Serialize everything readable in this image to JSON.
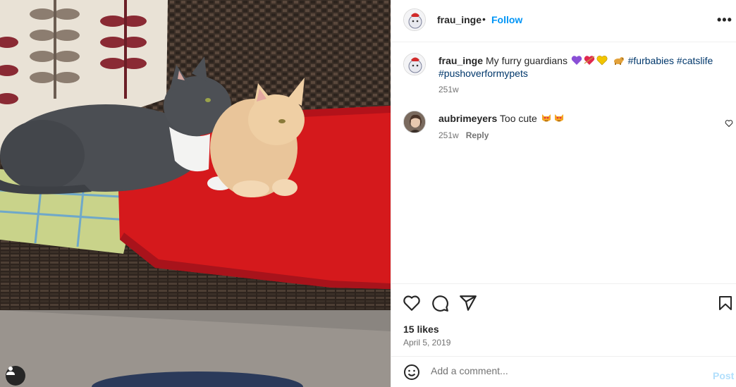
{
  "post": {
    "author": "frau_inge",
    "separator": "•",
    "follow_label": "Follow",
    "more_icon": "more-horizontal-icon",
    "more_glyph": "•••"
  },
  "caption": {
    "username": "frau_inge",
    "text": "My furry guardians",
    "emojis": [
      "purple-heart",
      "heart-with-arrow",
      "yellow-heart",
      "dog"
    ],
    "hashtags": [
      "#furbabies",
      "#catslife",
      "#pushoverformypets"
    ],
    "time": "251w"
  },
  "comments": [
    {
      "username": "aubrimeyers",
      "text": "Too cute",
      "emojis": [
        "smiling-cat-heart-eyes",
        "smiling-cat-heart-eyes"
      ],
      "time": "251w",
      "reply_label": "Reply"
    }
  ],
  "actions": {
    "icons": [
      "heart-icon",
      "comment-icon",
      "share-icon",
      "bookmark-icon"
    ],
    "likes": "15 likes",
    "date": "April 5, 2019"
  },
  "composer": {
    "placeholder": "Add a comment...",
    "post_label": "Post"
  },
  "colors": {
    "link_blue": "#0095f6",
    "hashtag": "#00376b",
    "secondary_text": "#737373",
    "post_disabled": "#b2dffc"
  }
}
